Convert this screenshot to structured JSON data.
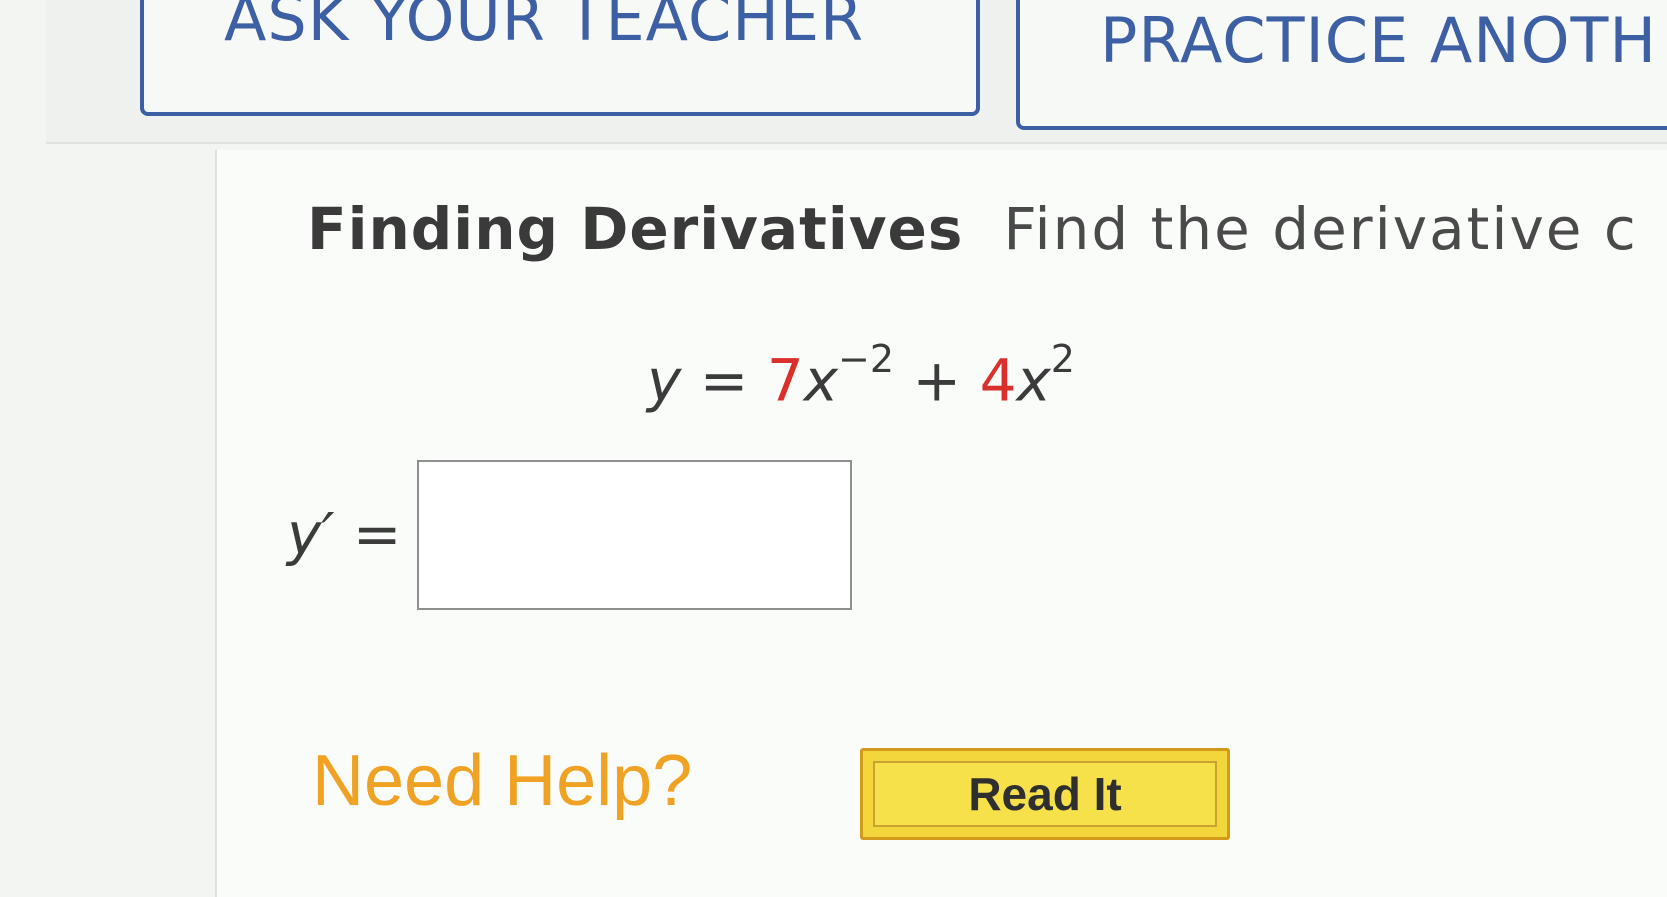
{
  "toolbar": {
    "ask_teacher_label": "ASK YOUR TEACHER",
    "practice_label": "PRACTICE ANOTH"
  },
  "question": {
    "title": "Finding Derivatives",
    "prompt": "Find the derivative c",
    "equation": {
      "lhs": "y",
      "equals": "=",
      "term1_coef": "7",
      "term1_var": "x",
      "term1_exp": "−2",
      "plus": "+",
      "term2_coef": "4",
      "term2_var": "x",
      "term2_exp": "2"
    },
    "answer_label": "y′ =",
    "answer_value": ""
  },
  "help": {
    "label": "Need Help?",
    "read_it_label": "Read It"
  },
  "colors": {
    "button_border": "#3d5fa3",
    "coefficient": "#d9302c",
    "help_text": "#f0a224",
    "read_it_bg": "#f7e14a"
  }
}
